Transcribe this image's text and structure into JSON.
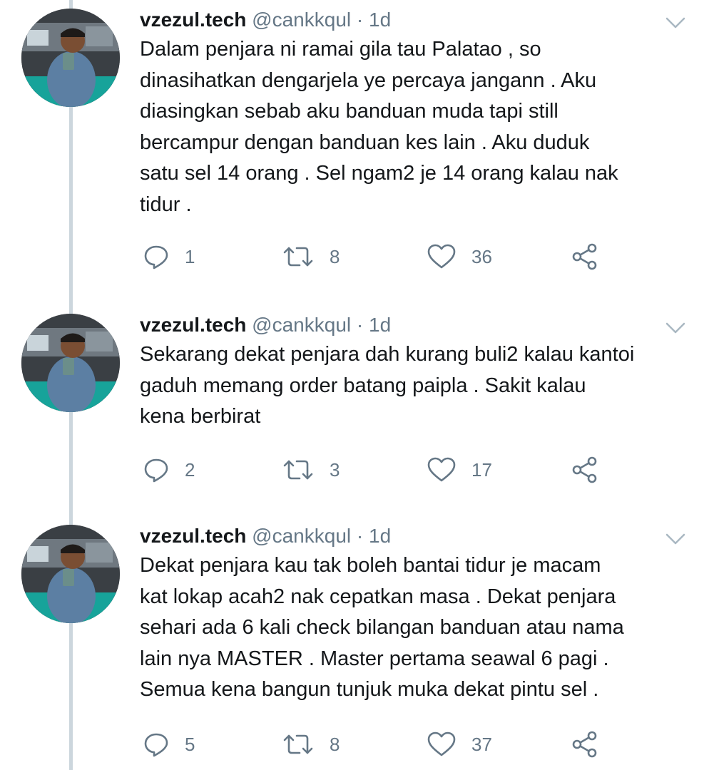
{
  "tweets": [
    {
      "name": "vzezul.tech",
      "handle": "@cankkqul",
      "separator": "·",
      "time": "1d",
      "text": "Dalam penjara ni ramai gila tau Palatao , so\ndinasihatkan dengarjela ye percaya jangann . Aku\ndiasingkan sebab aku banduan muda tapi still\nbercampur dengan banduan kes  lain . Aku duduk\nsatu sel 14 orang . Sel ngam2 je 14 orang kalau nak\ntidur .",
      "replies": "1",
      "retweets": "8",
      "likes": "36"
    },
    {
      "name": "vzezul.tech",
      "handle": "@cankkqul",
      "separator": "·",
      "time": "1d",
      "text": "Sekarang dekat penjara dah kurang buli2 kalau kantoi\ngaduh memang order batang paipla . Sakit kalau\nkena berbirat",
      "replies": "2",
      "retweets": "3",
      "likes": "17"
    },
    {
      "name": "vzezul.tech",
      "handle": "@cankkqul",
      "separator": "·",
      "time": "1d",
      "text": "Dekat penjara kau tak boleh bantai tidur  je macam\nkat lokap acah2 nak cepatkan masa . Dekat penjara\nsehari ada 6 kali check bilangan banduan atau nama\nlain nya MASTER . Master pertama seawal 6 pagi .\nSemua kena bangun tunjuk muka dekat pintu sel .",
      "replies": "5",
      "retweets": "8",
      "likes": "37"
    }
  ],
  "icons": {
    "reply": "reply-icon",
    "retweet": "retweet-icon",
    "like": "heart-icon",
    "share": "share-icon",
    "menu": "chevron-down-icon"
  },
  "colors": {
    "text": "#14171a",
    "secondary": "#657786",
    "thread_line": "#ccd6dd"
  }
}
